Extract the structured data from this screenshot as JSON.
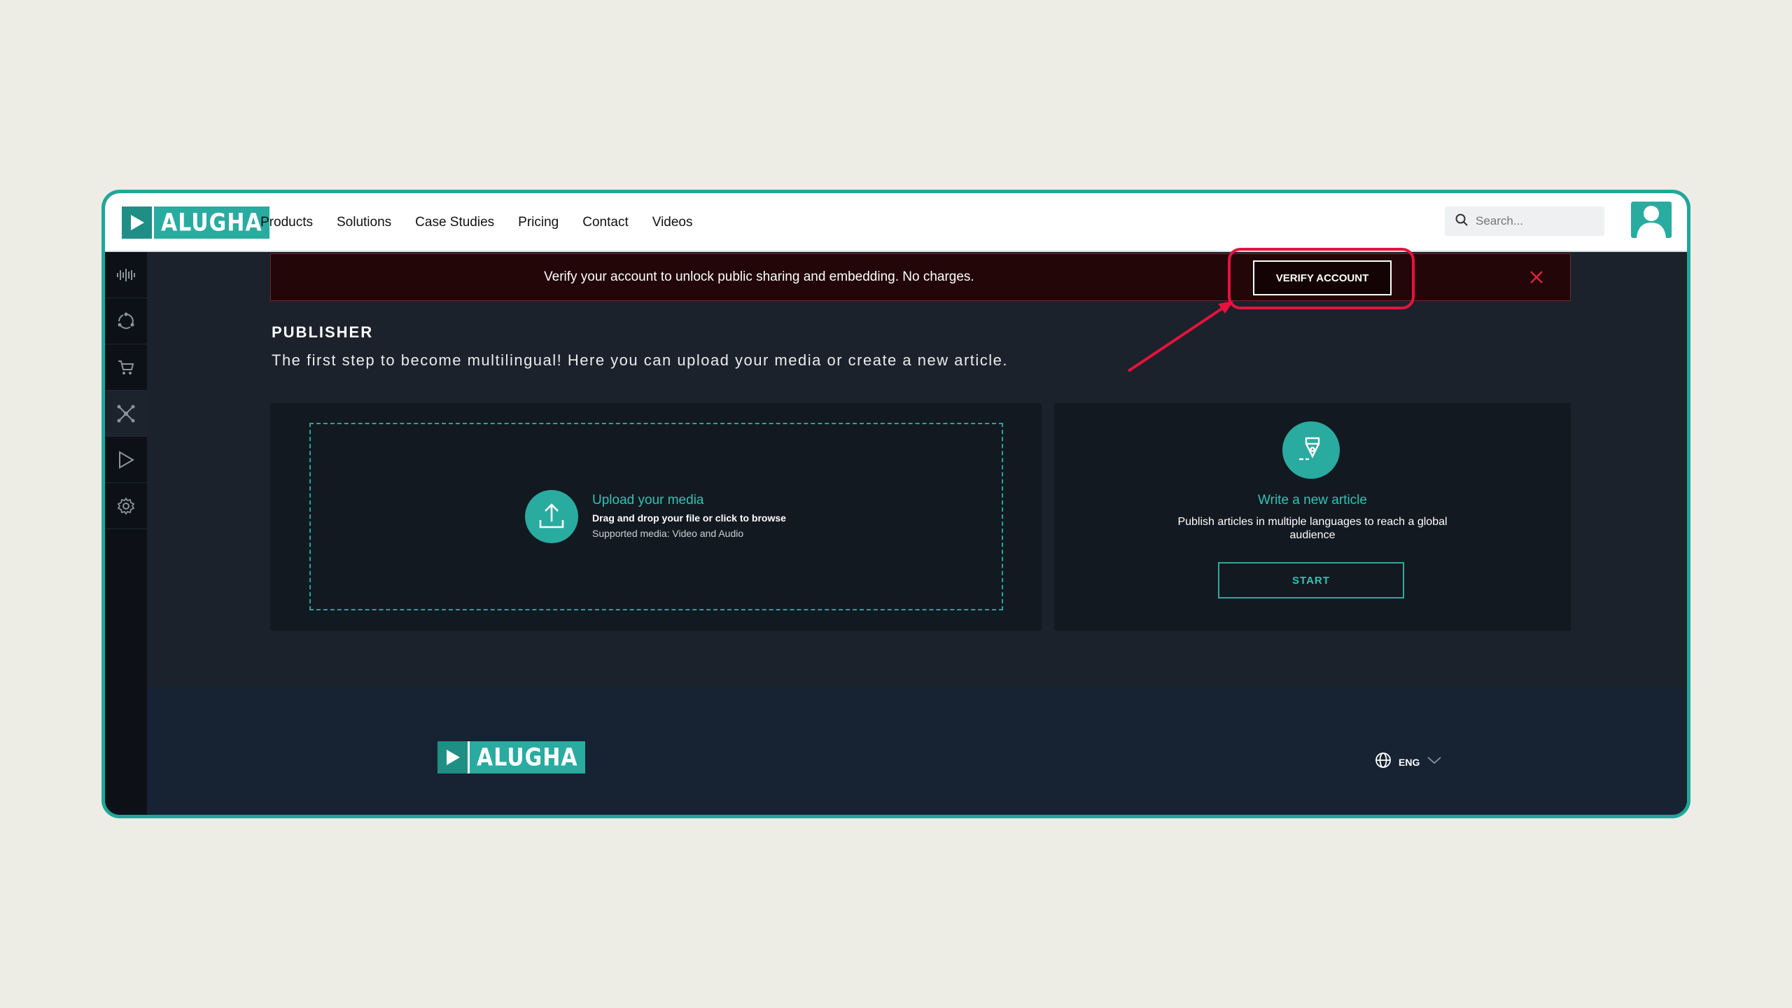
{
  "brand": {
    "name": "ALUGHA"
  },
  "nav": {
    "items": [
      {
        "label": "Products"
      },
      {
        "label": "Solutions"
      },
      {
        "label": "Case Studies"
      },
      {
        "label": "Pricing"
      },
      {
        "label": "Contact"
      },
      {
        "label": "Videos"
      }
    ]
  },
  "search": {
    "placeholder": "Search..."
  },
  "sidebar": {
    "items": [
      {
        "icon": "soundwave-icon"
      },
      {
        "icon": "cycle-icon"
      },
      {
        "icon": "cart-icon"
      },
      {
        "icon": "network-icon"
      },
      {
        "icon": "play-icon"
      },
      {
        "icon": "gear-icon"
      }
    ],
    "active_index": 3
  },
  "banner": {
    "message": "Verify your account to unlock public sharing and embedding. No charges.",
    "button_label": "VERIFY ACCOUNT"
  },
  "publisher": {
    "heading": "PUBLISHER",
    "subheading": "The first step to become multilingual! Here you can upload your media or create a new article.",
    "upload": {
      "title": "Upload your media",
      "line1": "Drag and drop your file or click to browse",
      "line2": "Supported media: Video and Audio"
    },
    "article": {
      "title": "Write a new article",
      "description": "Publish articles in multiple languages to reach a global audience",
      "button_label": "START"
    }
  },
  "footer": {
    "language": "ENG"
  },
  "colors": {
    "accent": "#2aaba0",
    "frame_border": "#1fa79b",
    "annotation": "#e8113d",
    "banner_bg": "#220608"
  }
}
